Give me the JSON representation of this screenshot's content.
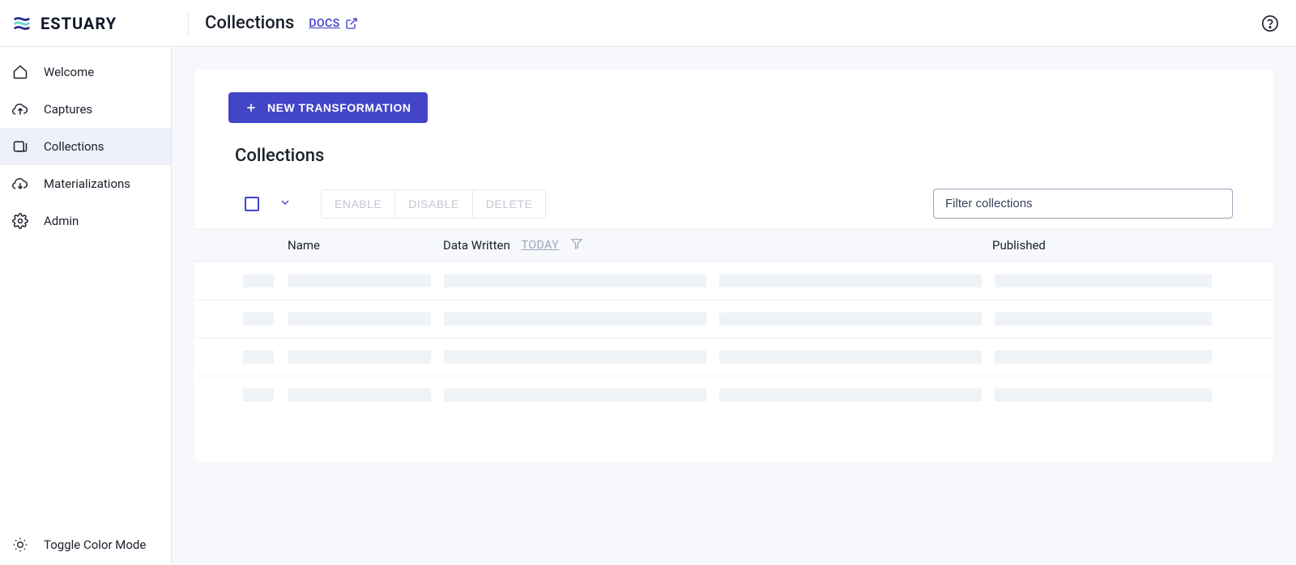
{
  "brand": "ESTUARY",
  "header": {
    "title": "Collections",
    "docs_label": "DOCS"
  },
  "sidebar": {
    "items": [
      {
        "label": "Welcome"
      },
      {
        "label": "Captures"
      },
      {
        "label": "Collections"
      },
      {
        "label": "Materializations"
      },
      {
        "label": "Admin"
      }
    ],
    "toggle_label": "Toggle Color Mode"
  },
  "main": {
    "new_button": "NEW TRANSFORMATION",
    "section_title": "Collections",
    "actions": {
      "enable": "ENABLE",
      "disable": "DISABLE",
      "delete": "DELETE"
    },
    "filter_placeholder": "Filter collections",
    "columns": {
      "name": "Name",
      "data_written": "Data Written",
      "today": "TODAY",
      "published": "Published"
    }
  }
}
